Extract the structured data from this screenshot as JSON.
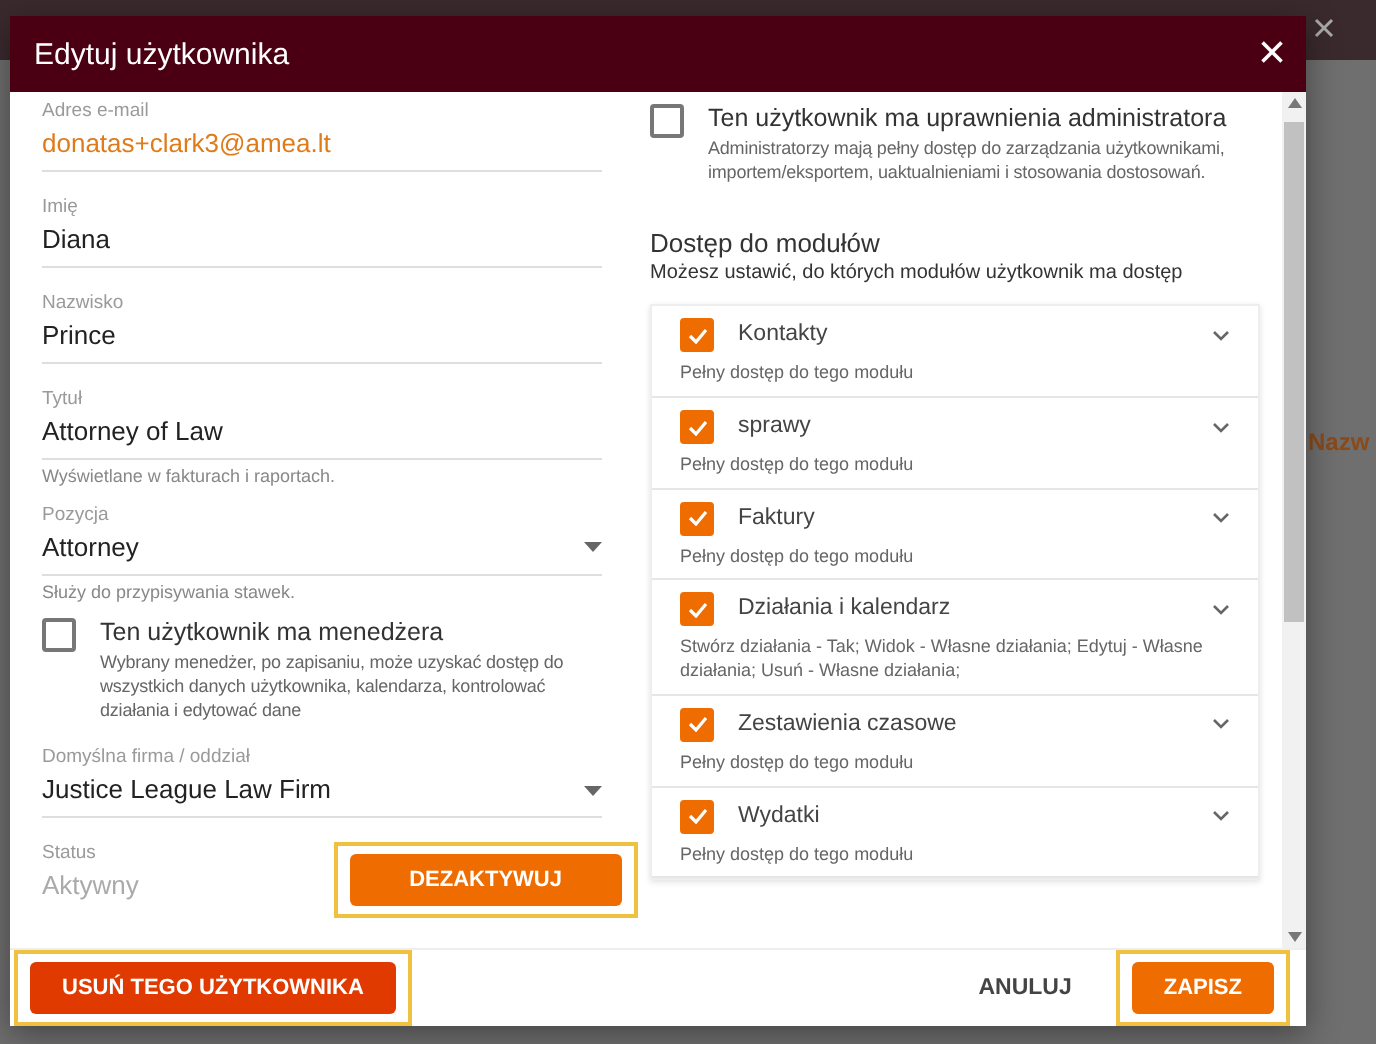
{
  "backdrop": {
    "text": "Nazw"
  },
  "dialog": {
    "title": "Edytuj użytkownika",
    "close": "×"
  },
  "fields": [
    {
      "kind": "email",
      "label": "Adres e-mail",
      "value": "donatas+clark3@amea.lt"
    },
    {
      "kind": "text",
      "label": "Imię",
      "value": "Diana"
    },
    {
      "kind": "text",
      "label": "Nazwisko",
      "value": "Prince"
    },
    {
      "kind": "text",
      "label": "Tytuł",
      "value": "Attorney of Law",
      "hint": "Wyświetlane w fakturach i raportach."
    },
    {
      "kind": "select",
      "label": "Pozycja",
      "value": "Attorney",
      "hint": "Służy do przypisywania stawek."
    },
    {
      "kind": "checkbox",
      "label": "Ten użytkownik ma menedżera",
      "checked": false,
      "hint": "Wybrany menedżer, po zapisaniu, może uzyskać dostęp do wszystkich danych użytkownika, kalendarza, kontrolować działania i edytować dane"
    },
    {
      "kind": "select",
      "label": "Domyślna firma / oddział",
      "value": "Justice League Law Firm"
    },
    {
      "kind": "status",
      "label": "Status",
      "value": "Aktywny",
      "button": "DEZAKTYWUJ"
    }
  ],
  "admin": {
    "label": "Ten użytkownik ma uprawnienia administratora",
    "checked": false,
    "hint": "Administratorzy mają pełny dostęp do zarządzania użytkownikami, importem/eksportem, uaktualnieniami i stosowania dostosowań."
  },
  "modules": {
    "title": "Dostęp do modułów",
    "subtitle": "Możesz ustawić, do których modułów użytkownik ma dostęp",
    "items": [
      {
        "name": "Kontakty",
        "checked": true,
        "description": "Pełny dostęp do tego modułu"
      },
      {
        "name": "sprawy",
        "checked": true,
        "description": "Pełny dostęp do tego modułu"
      },
      {
        "name": "Faktury",
        "checked": true,
        "description": "Pełny dostęp do tego modułu"
      },
      {
        "name": "Działania i kalendarz",
        "checked": true,
        "description": "Stwórz działania - Tak; Widok - Własne działania; Edytuj - Własne działania; Usuń - Własne działania;"
      },
      {
        "name": "Zestawienia czasowe",
        "checked": true,
        "description": "Pełny dostęp do tego modułu"
      },
      {
        "name": "Wydatki",
        "checked": true,
        "description": "Pełny dostęp do tego modułu"
      }
    ]
  },
  "footer": {
    "delete": "USUŃ TEGO UŻYTKOWNIKA",
    "cancel": "ANULUJ",
    "save": "ZAPISZ"
  }
}
